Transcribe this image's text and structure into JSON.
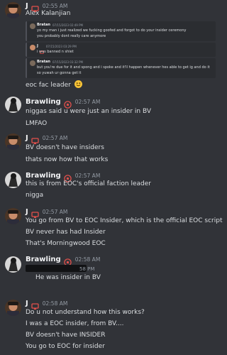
{
  "messages": [
    {
      "author": "J",
      "time": "02:55 AM",
      "lines": [
        "Alex Kalanjian"
      ],
      "embeds": [
        {
          "author": "Bratan",
          "time": "07/15/2023 02:49 PM",
          "lines": [
            "yo my man i just realized we fucking goofed and forgot to do your insider ceremony",
            "you probably dont really care anymore"
          ]
        },
        {
          "author": "J",
          "time": "07/15/2023 03:29 PM",
          "lines": [
            "i was banned n shiet"
          ]
        },
        {
          "author": "Bratan",
          "time": "07/15/2023 03:32 PM",
          "lines": [
            "but you're due for it and spong and i spoke and it'll happen whenever hes able to get ig and do it",
            "so yuwah ur gonna get it"
          ]
        }
      ],
      "after": [
        "eoc fac leader"
      ]
    },
    {
      "author": "Brawling",
      "time": "02:57 AM",
      "lines": [
        "niggas said u were just an insider in BV",
        "LMFAO"
      ]
    },
    {
      "author": "J",
      "time": "02:57 AM",
      "lines": [
        "BV doesn't have insiders",
        "thats now how that works"
      ]
    },
    {
      "author": "Brawling",
      "time": "02:57 AM",
      "lines": [
        "this is from EOC's official faction leader",
        "nigga"
      ]
    },
    {
      "author": "J",
      "time": "02:57 AM",
      "lines": [
        "You go from BV to EOC Insider, which is the official EOC script",
        "BV never has had Insider",
        "That's Morningwood EOC"
      ]
    },
    {
      "author": "Brawling",
      "time": "02:58 AM",
      "lines": [
        "He was insider in BV"
      ],
      "cut_time": "58 PM"
    },
    {
      "author": "J",
      "time": "02:58 AM",
      "lines": [
        "Do u not understand how this works?",
        "I was a EOC insider, from BV....",
        "BV doesn't have INSIDER",
        "You go to EOC for insider"
      ]
    }
  ],
  "colors": {
    "background": "#313338",
    "embed_background": "#2b2d31",
    "username": "#f2f3f5",
    "timestamp": "#949ba4",
    "text": "#dbdee1",
    "tag_red": "#e2504c"
  },
  "icons": {
    "j_tag": "monitor-icon",
    "brawling_tag": "roblox-icon",
    "emoji": "slightly-smiling-face-emoji"
  }
}
